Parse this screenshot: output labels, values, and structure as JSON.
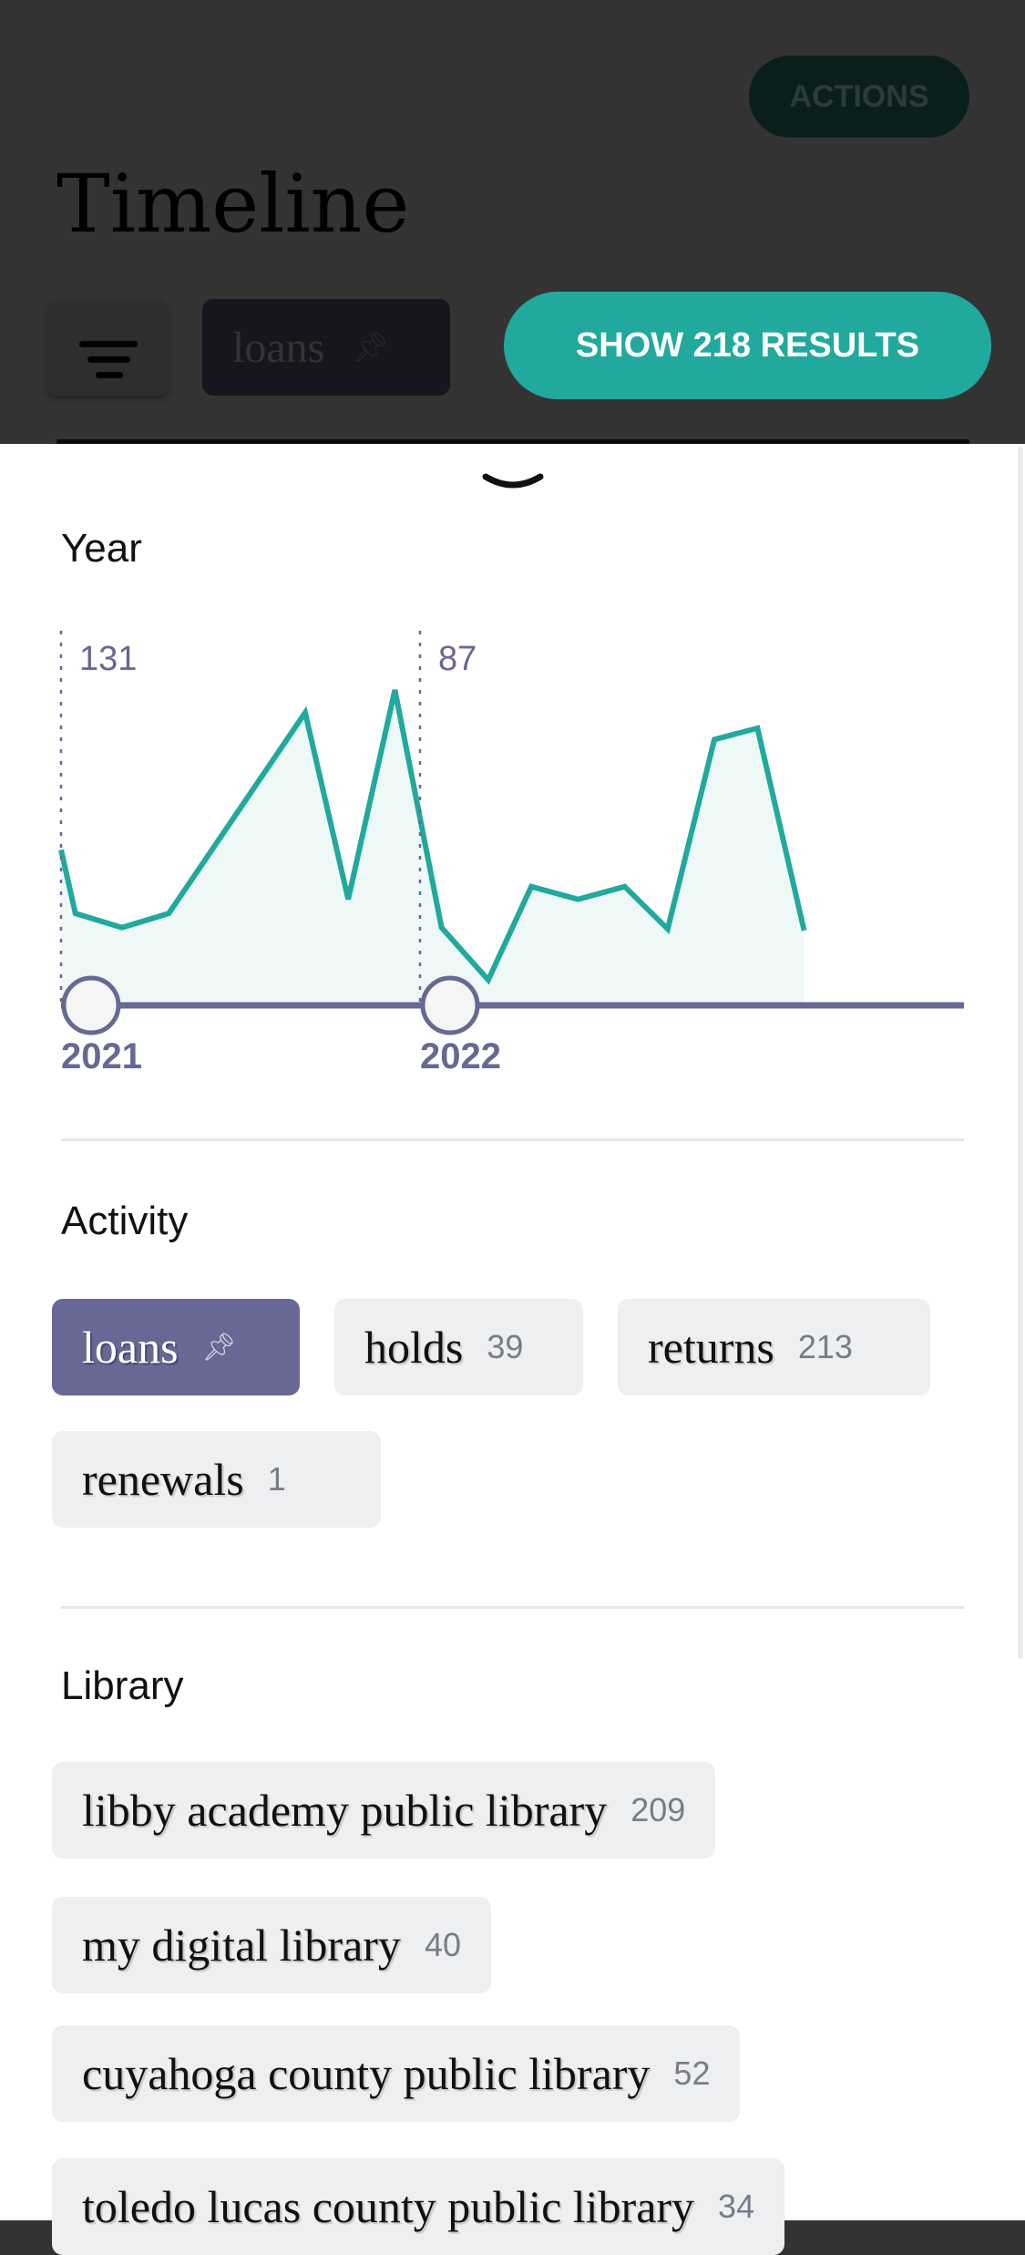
{
  "header": {
    "actions_label": "ACTIONS",
    "title": "Timeline",
    "filter_icon": "filter-lines-icon",
    "pinned_filter": {
      "label": "loans",
      "icon": "pin-icon"
    },
    "show_results_label": "SHOW 218 RESULTS"
  },
  "sheet": {
    "collapse_icon": "chevron-down-icon",
    "year_section": {
      "title": "Year"
    },
    "activity_section": {
      "title": "Activity",
      "chips": [
        {
          "label": "loans",
          "count": "",
          "selected": true,
          "icon": "pin-icon"
        },
        {
          "label": "holds",
          "count": "39",
          "selected": false
        },
        {
          "label": "returns",
          "count": "213",
          "selected": false
        },
        {
          "label": "renewals",
          "count": "1",
          "selected": false
        }
      ]
    },
    "library_section": {
      "title": "Library",
      "chips": [
        {
          "label": "libby academy public library",
          "count": "209"
        },
        {
          "label": "my digital library",
          "count": "40"
        },
        {
          "label": "cuyahoga county public library",
          "count": "52"
        },
        {
          "label": "toledo lucas county public library",
          "count": "34"
        }
      ]
    }
  },
  "colors": {
    "accent": "#22a99d",
    "selected_chip": "#676894",
    "area_fill": "#eef8f6",
    "axis": "#676894"
  },
  "chart_data": {
    "type": "area",
    "x_tick_labels": [
      "2021",
      "2022"
    ],
    "year_totals": [
      {
        "year": "2021",
        "value": "131"
      },
      {
        "year": "2022",
        "value": "87"
      }
    ],
    "x": [
      2021.0,
      2021.04,
      2021.17,
      2021.3,
      2021.68,
      2021.8,
      2021.93,
      2022.06,
      2022.19,
      2022.31,
      2022.44,
      2022.57,
      2022.69,
      2022.82,
      2022.94,
      2023.07
    ],
    "values": [
      11,
      6.5,
      5.5,
      6.5,
      20.7,
      7.5,
      22.3,
      5.5,
      1.8,
      8.4,
      7.5,
      8.4,
      5.4,
      18.8,
      19.6,
      5.3
    ],
    "x_range": [
      2021.0,
      2023.5
    ],
    "y_range": [
      0,
      22.3
    ],
    "grid": false,
    "slider_handles": [
      "2021",
      "2022"
    ]
  }
}
